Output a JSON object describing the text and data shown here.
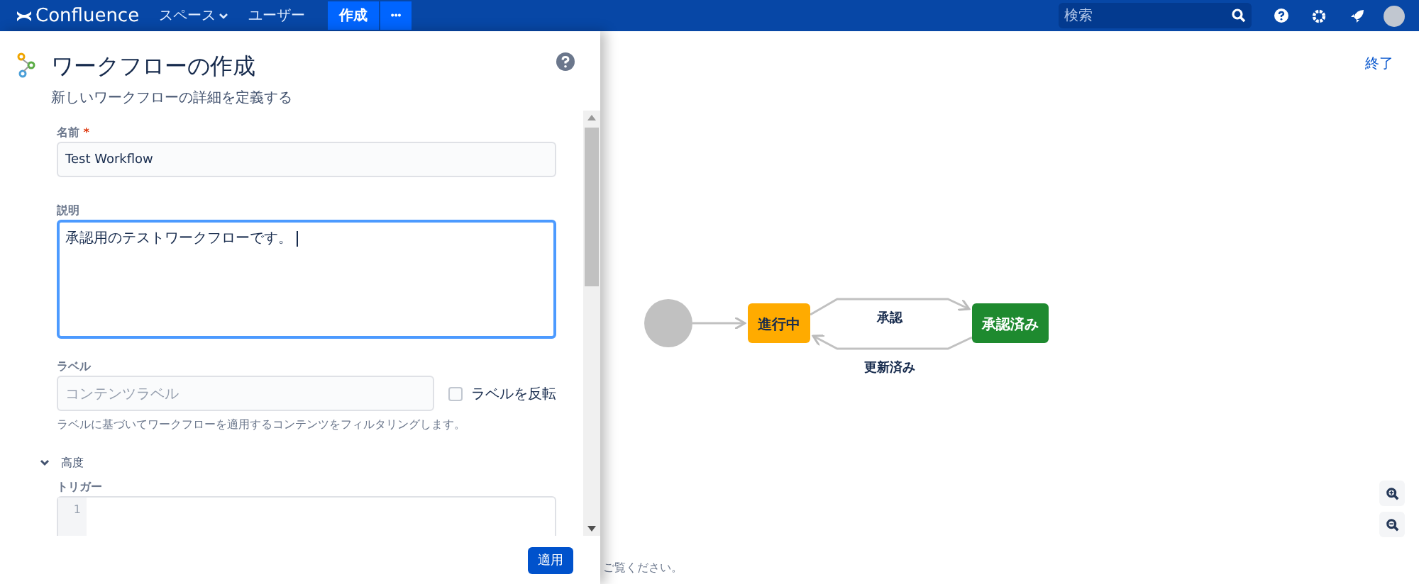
{
  "header": {
    "logo": "Confluence",
    "nav": [
      {
        "label": "スペース",
        "dropdown": true
      },
      {
        "label": "ユーザー",
        "dropdown": false
      }
    ],
    "create": "作成",
    "more": "•••",
    "search": {
      "placeholder": "検索"
    }
  },
  "panel": {
    "title": "ワークフローの作成",
    "subtitle": "新しいワークフローの詳細を定義する",
    "name": {
      "label": "名前",
      "required_mark": "*",
      "value": "Test Workflow"
    },
    "description": {
      "label": "説明",
      "value": "承認用のテストワークフローです。",
      "focused": true
    },
    "labels": {
      "label": "ラベル",
      "placeholder": "コンテンツラベル",
      "help": "ラベルに基づいてワークフローを適用するコンテンツをフィルタリングします。"
    },
    "invert": {
      "label": "ラベルを反転",
      "checked": false
    },
    "advanced": {
      "label": "高度",
      "expanded": true
    },
    "trigger": {
      "label": "トリガー",
      "line_numbers": [
        "1"
      ]
    },
    "apply": "適用"
  },
  "canvas": {
    "exit": "終了",
    "footer_text": "ご覧ください。",
    "nodes": [
      {
        "label": "進行中",
        "color": "#ffab00"
      },
      {
        "label": "承認済み",
        "color": "#1e8a2f"
      }
    ],
    "edges": [
      {
        "label": "承認"
      },
      {
        "label": "更新済み"
      }
    ]
  }
}
